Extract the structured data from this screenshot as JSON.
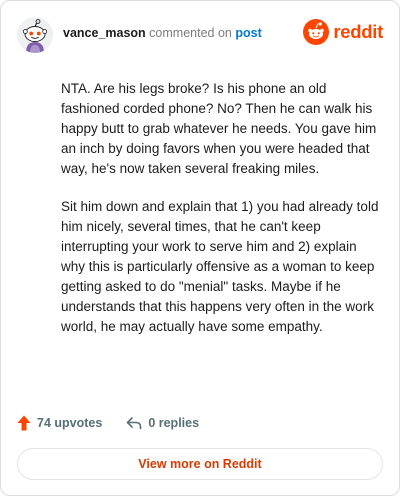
{
  "header": {
    "username": "vance_mason",
    "action_text": "commented on",
    "post_link": "post",
    "brand_wordmark": "reddit",
    "avatar_icon": "reddit-snoo-avatar-icon",
    "brand_icon": "reddit-alien-logo-icon"
  },
  "comment": {
    "paragraphs": [
      "NTA. Are his legs broke? Is his phone an old fashioned corded phone? No? Then he can walk his happy butt to grab whatever he needs. You gave him an inch by doing favors when you were headed that way, he's now taken several freaking miles.",
      "Sit him down and explain that 1) you had already told him nicely, several times, that he can't keep interrupting your work to serve him and 2) explain why this is particularly offensive as a woman to keep getting asked to do \"menial\" tasks. Maybe if he understands that this happens very often in the work world, he may actually have some empathy."
    ]
  },
  "footer": {
    "upvotes_label": "74 upvotes",
    "replies_label": "0 replies",
    "upvote_icon": "upvote-arrow-icon",
    "reply_icon": "reply-arrow-icon"
  },
  "cta": {
    "view_more_label": "View more on Reddit"
  },
  "colors": {
    "brand_orange": "#ff4500",
    "upvote_orange": "#ff4500",
    "link_blue": "#0079d3",
    "cta_text": "#d93a00",
    "meta_gray": "#576f76"
  }
}
